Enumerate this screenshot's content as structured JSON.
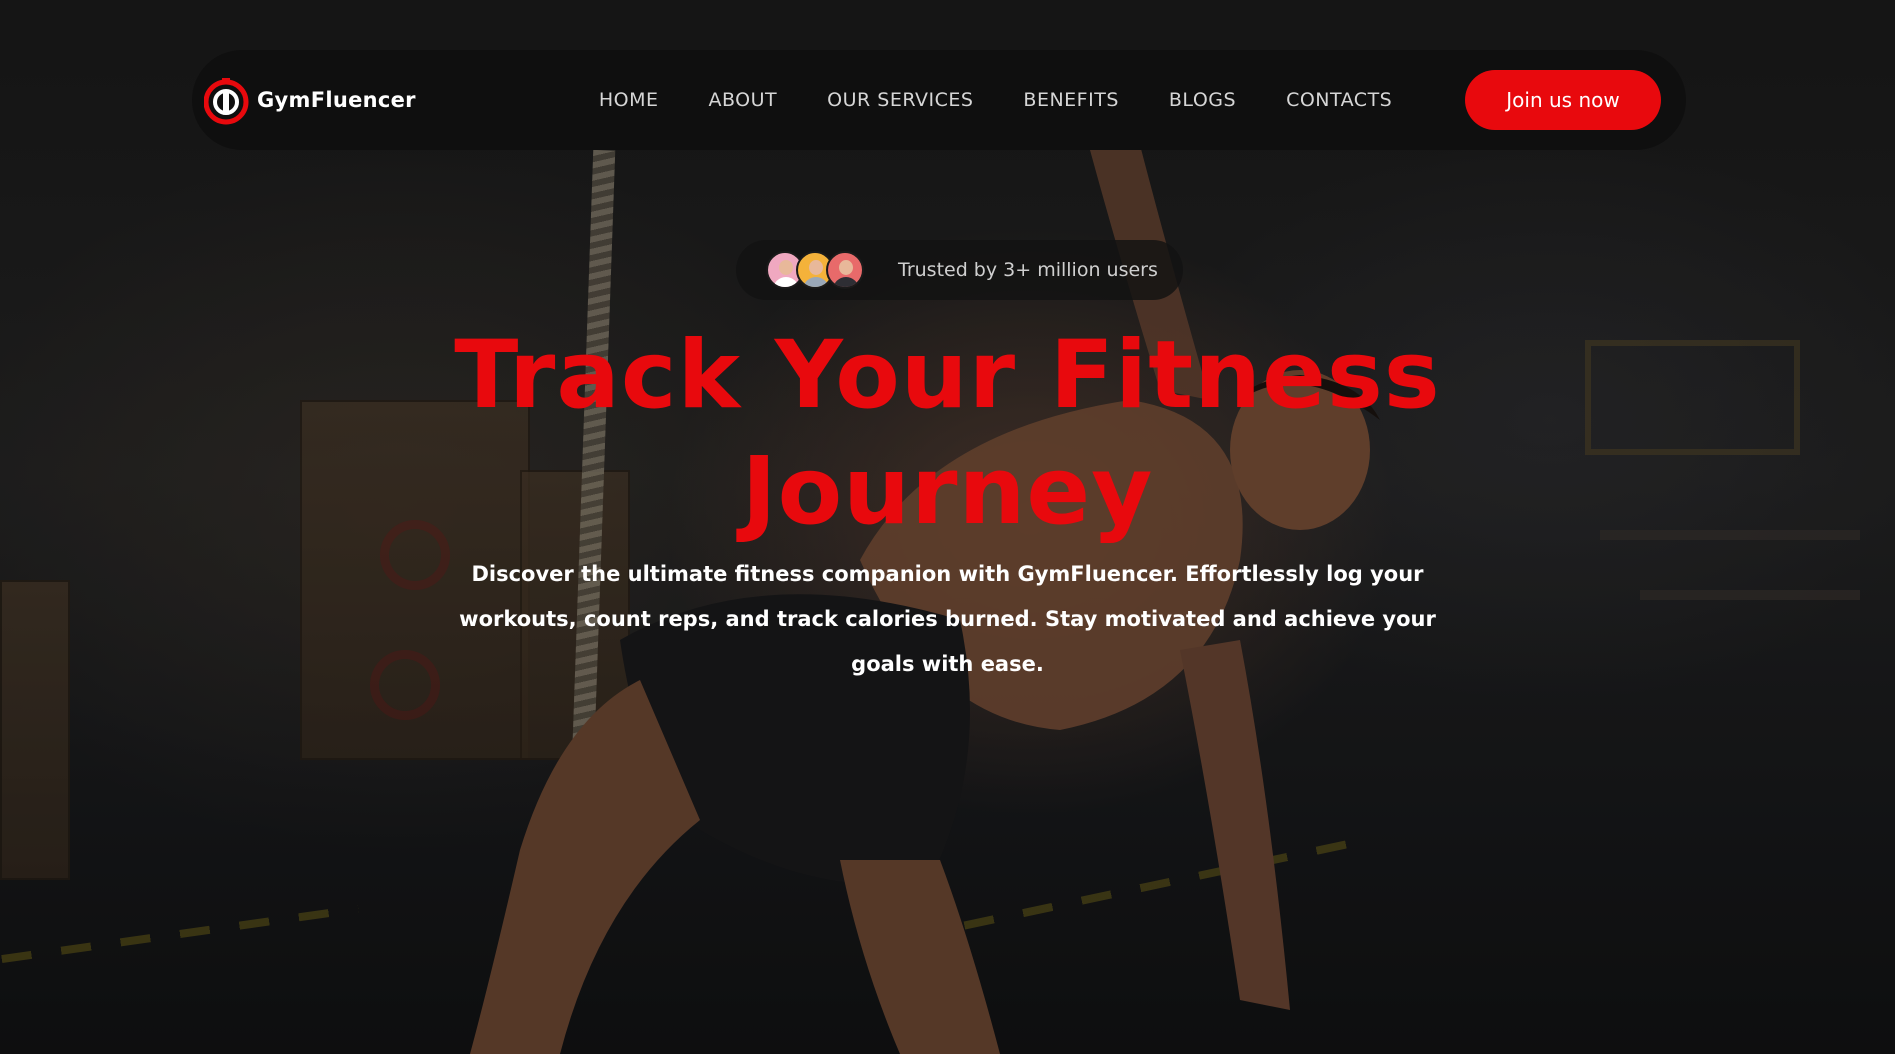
{
  "brand": {
    "name": "GymFluencer",
    "accent": "#e8090d"
  },
  "nav": {
    "items": [
      {
        "label": "HOME"
      },
      {
        "label": "ABOUT"
      },
      {
        "label": "OUR SERVICES"
      },
      {
        "label": "BENEFITS"
      },
      {
        "label": "BLOGS"
      },
      {
        "label": "CONTACTS"
      }
    ],
    "cta_label": "Join us now"
  },
  "trust": {
    "text": "Trusted by 3+ million users",
    "avatars": [
      "user-avatar-woman",
      "user-avatar-man-glasses",
      "user-avatar-man-beard"
    ]
  },
  "hero": {
    "title_line1": "Track Your Fitness",
    "title_line2": "Journey",
    "description": "Discover the ultimate fitness companion with GymFluencer. Effortlessly log your workouts, count reps, and track calories burned. Stay motivated and achieve your goals with ease."
  },
  "background_image": "gym-athlete-photo"
}
